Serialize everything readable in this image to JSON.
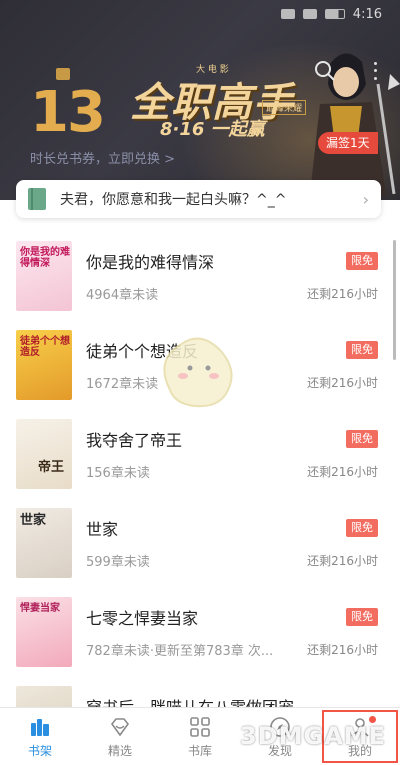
{
  "status_bar": {
    "time": "4:16"
  },
  "banner": {
    "number": "13",
    "title": "全职高手",
    "small_label": "大 电 影",
    "tag": "巅峰荣耀",
    "date": "8·16 一起赢",
    "caption": "时长兑书券，立即兑换 >",
    "signin_label": "漏签1天"
  },
  "message": {
    "text": "夫君，你愿意和我一起白头嘛？^_^"
  },
  "books": [
    {
      "title": "你是我的难得情深",
      "meta": "4964章未读",
      "badge": "限免",
      "remaining": "还剩216小时",
      "cover_text": "你是我的难得情深",
      "cover_color": "#fbe3ec"
    },
    {
      "title": "徒弟个个想造反",
      "meta": "1672章未读",
      "badge": "限免",
      "remaining": "还剩216小时",
      "cover_text": "徒弟个个想造反",
      "cover_color": "#f7c443"
    },
    {
      "title": "我夺舍了帝王",
      "meta": "156章未读",
      "badge": "限免",
      "remaining": "还剩216小时",
      "cover_text": "帝王",
      "cover_color": "#f3ede3"
    },
    {
      "title": "世家",
      "meta": "599章未读",
      "badge": "限免",
      "remaining": "还剩216小时",
      "cover_text": "世家",
      "cover_color": "#ece6df"
    },
    {
      "title": "七零之悍妻当家",
      "meta": "782章未读·更新至第783章 次...",
      "badge": "限免",
      "remaining": "还剩216小时",
      "cover_text": "悍妻当家",
      "cover_color": "#f9d6df"
    },
    {
      "title": "穿书后，胖喵儿在八零做团宠",
      "meta": "",
      "badge": "",
      "remaining": "",
      "cover_text": "",
      "cover_color": "#e9e4d8"
    }
  ],
  "nav": [
    {
      "label": "书架",
      "icon": "bookshelf-icon",
      "active": true
    },
    {
      "label": "精选",
      "icon": "diamond-icon",
      "active": false
    },
    {
      "label": "书库",
      "icon": "grid-icon",
      "active": false
    },
    {
      "label": "发现",
      "icon": "compass-icon",
      "active": false
    },
    {
      "label": "我的",
      "icon": "person-icon",
      "active": false
    }
  ],
  "watermark": "3DMGAME",
  "colors": {
    "accent": "#2a8fe0",
    "badge": "#f36c60",
    "banner_bg": "#2f2e36",
    "gold": "#e3ad4f"
  }
}
